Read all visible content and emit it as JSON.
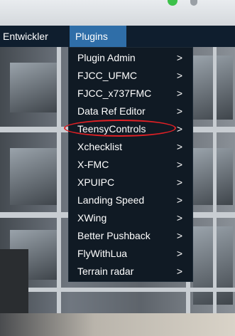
{
  "menubar": {
    "items": [
      {
        "label": "Entwickler"
      },
      {
        "label": "Plugins"
      }
    ]
  },
  "plugins_menu": {
    "submenu_arrow": ">",
    "items": [
      {
        "label": "Plugin Admin"
      },
      {
        "label": "FJCC_UFMC"
      },
      {
        "label": "FJCC_x737FMC"
      },
      {
        "label": "Data Ref Editor"
      },
      {
        "label": "TeensyControls",
        "annotated": true
      },
      {
        "label": "Xchecklist"
      },
      {
        "label": "X-FMC"
      },
      {
        "label": "XPUIPC"
      },
      {
        "label": "Landing Speed"
      },
      {
        "label": "XWing"
      },
      {
        "label": "Better Pushback"
      },
      {
        "label": "FlyWithLua"
      },
      {
        "label": "Terrain radar"
      }
    ]
  },
  "colors": {
    "menubar_bg": "#0f1e2e",
    "active_menu_bg": "#2f6ea8",
    "dropdown_bg": "#101a24",
    "annotation_ring": "#e02025"
  }
}
